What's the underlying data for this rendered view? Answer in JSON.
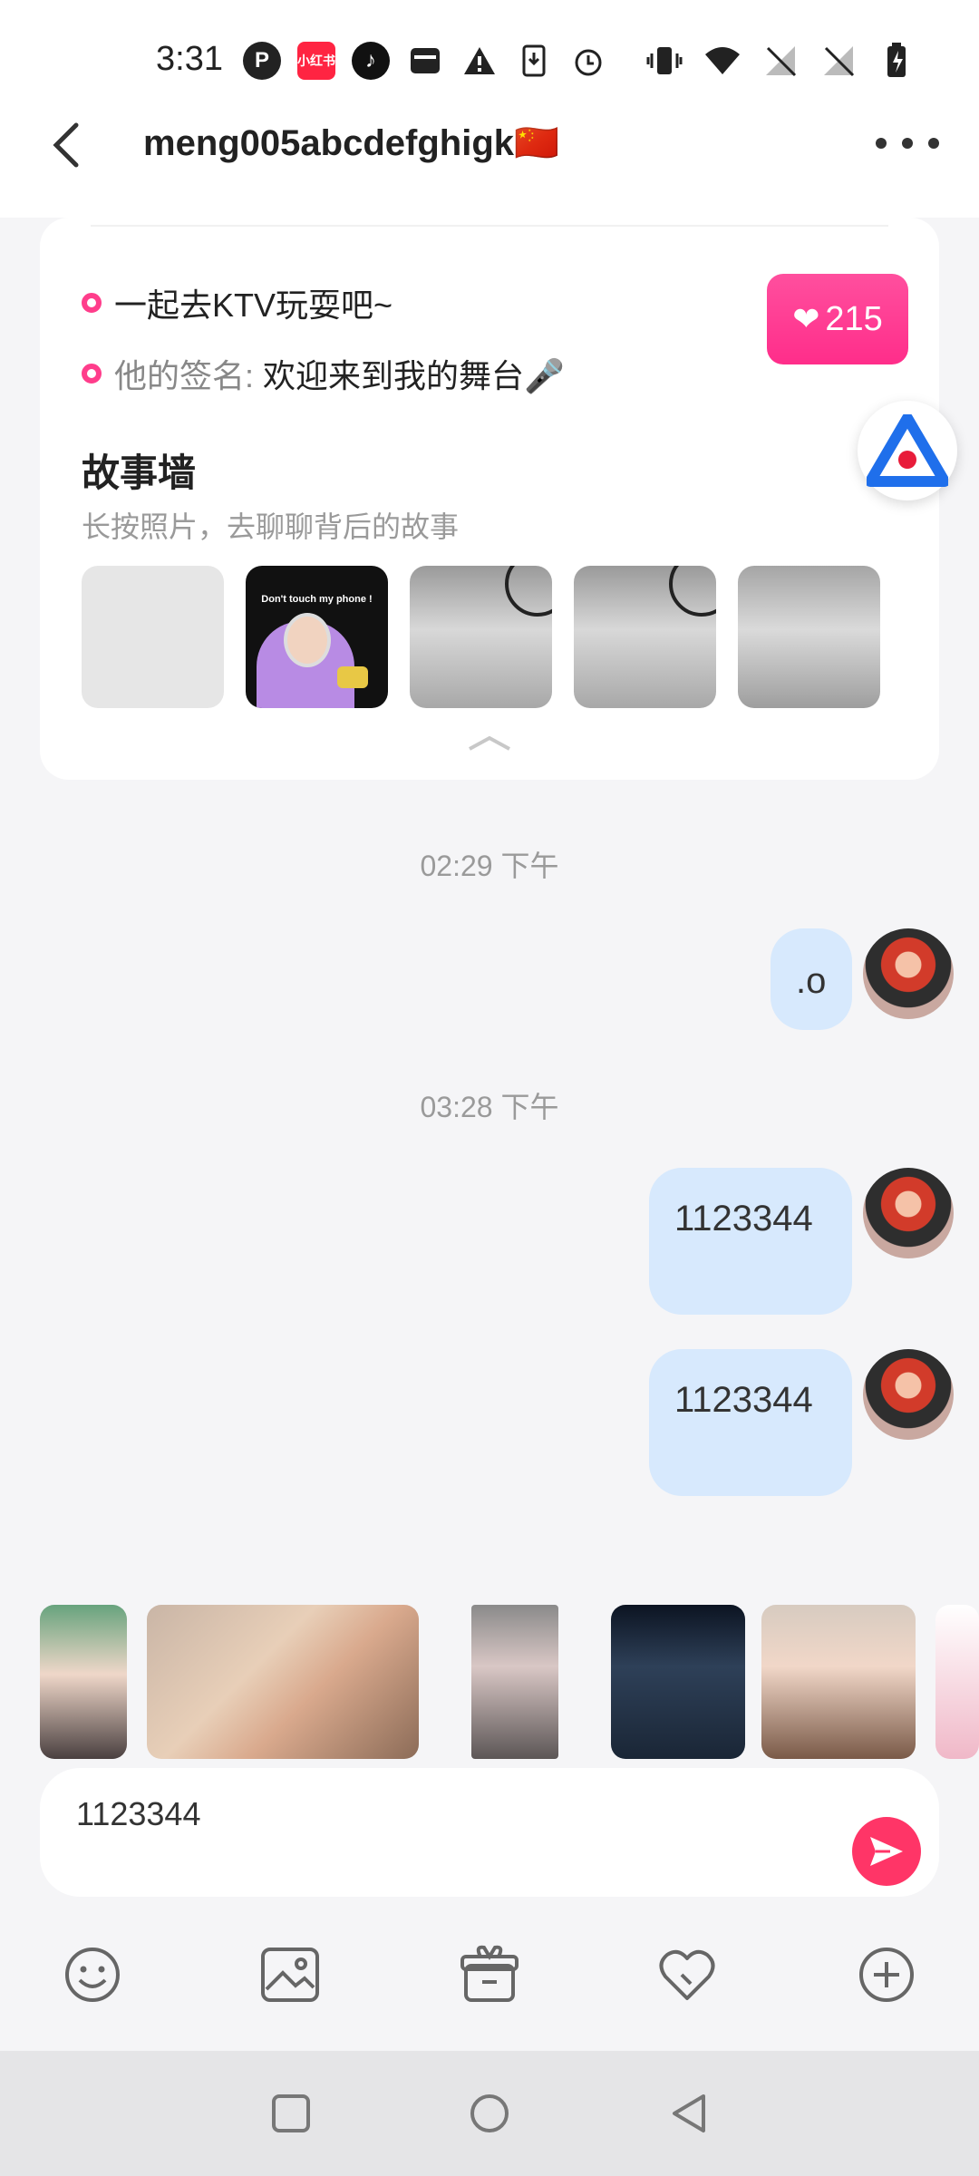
{
  "status_bar": {
    "time": "3:31",
    "left_icons": [
      "pinterest-like-icon",
      "xiaohongshu-icon",
      "tiktok-icon",
      "archive-icon",
      "warning-icon",
      "download-icon",
      "alarm-icon"
    ],
    "xiaohongshu_label": "小红书",
    "right_icons": [
      "vibrate-icon",
      "wifi-icon",
      "no-signal-icon",
      "no-signal-icon",
      "battery-charging-icon"
    ]
  },
  "header": {
    "title": "meng005abcdefghigk🇨🇳"
  },
  "profile_card": {
    "line1": "一起去KTV玩耍吧~",
    "signature_label": "他的签名:",
    "signature_value": "欢迎来到我的舞台🎤",
    "likes": "215",
    "story_title": "故事墙",
    "story_hint": "长按照片，去聊聊背后的故事",
    "thumb2_caption": "Don't touch my phone !"
  },
  "messages": {
    "timestamp1": "02:29 下午",
    "msg1": ".o",
    "timestamp2": "03:28 下午",
    "msg2": "1123344",
    "msg3": "1123344"
  },
  "input": {
    "value": "1123344"
  },
  "toolbar": [
    "emoji-icon",
    "image-icon",
    "gift-icon",
    "heart-chat-icon",
    "plus-icon"
  ],
  "colors": {
    "accent_pink": "#ff2d8a",
    "send_red": "#ff3567",
    "bubble_blue": "#d7e9fd"
  }
}
